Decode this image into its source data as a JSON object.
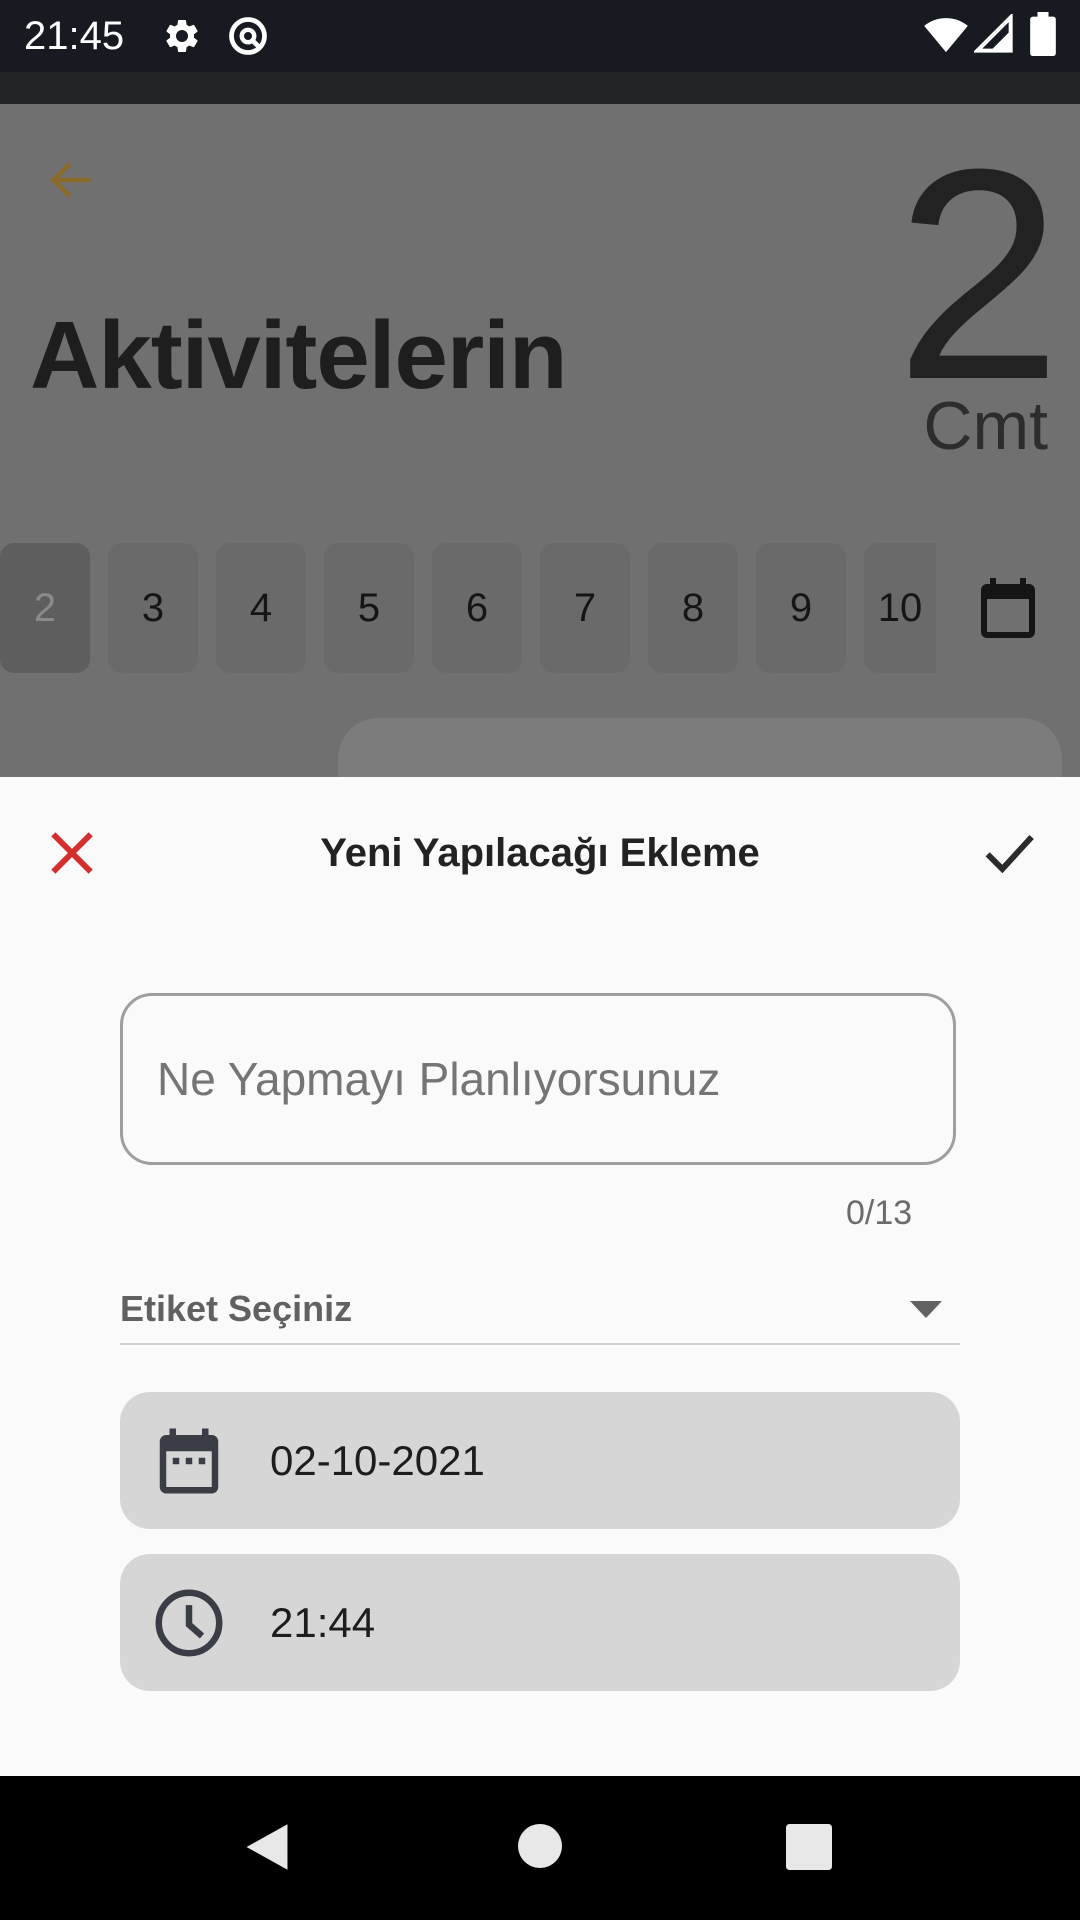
{
  "status_bar": {
    "time": "21:45",
    "left_icons": [
      "gear-icon",
      "do-not-disturb-icon"
    ],
    "right_icons": [
      "wifi-icon",
      "signal-icon",
      "battery-icon"
    ]
  },
  "background": {
    "back_icon": "arrow-left-icon",
    "title": "Aktivitelerin",
    "day_number": "2",
    "day_name": "Cmt",
    "days": [
      "2",
      "3",
      "4",
      "5",
      "6",
      "7",
      "8",
      "9",
      "10"
    ],
    "selected_day": "2",
    "calendar_icon": "calendar-icon"
  },
  "sheet": {
    "title": "Yeni Yapılacağı Ekleme",
    "close_icon": "close-icon",
    "confirm_icon": "check-icon",
    "input_placeholder": "Ne Yapmayı Planlıyorsunuz",
    "input_value": "",
    "char_counter": "0/13",
    "tag_label": "Etiket Seçiniz",
    "date_value": "02-10-2021",
    "time_value": "21:44"
  },
  "nav": {
    "back": "back-triangle-icon",
    "home": "home-circle-icon",
    "recents": "recents-square-icon"
  },
  "colors": {
    "accent_close": "#d32f2f",
    "accent_back": "#8a6a2a",
    "sheet_bg": "#fafafa",
    "field_bg": "#d6d6d6"
  }
}
